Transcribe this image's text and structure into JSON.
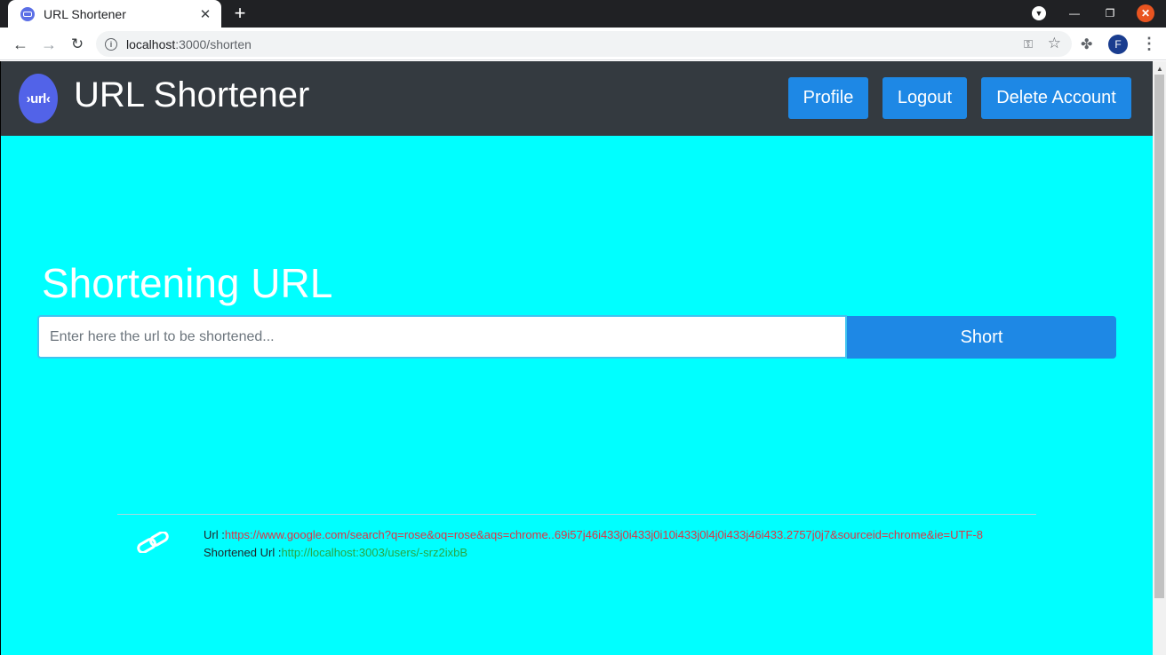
{
  "browser": {
    "tab_title": "URL Shortener",
    "tab_close": "✕",
    "new_tab": "+",
    "url_host": "localhost",
    "url_rest": ":3000/shorten",
    "profile_initial": "F"
  },
  "navbar": {
    "logo_text": "›url‹",
    "brand": "URL Shortener",
    "profile_label": "Profile",
    "logout_label": "Logout",
    "delete_label": "Delete Account"
  },
  "main": {
    "heading": "Shortening URL",
    "input_placeholder": "Enter here the url to be shortened...",
    "input_value": "",
    "short_label": "Short"
  },
  "result": {
    "url_label": "Url :",
    "url_value": "https://www.google.com/search?q=rose&oq=rose&aqs=chrome..69i57j46i433j0i433j0i10i433j0l4j0i433j46i433.2757j0j7&sourceid=chrome&ie=UTF-8",
    "short_label": "Shortened Url :",
    "short_value": "http://localhost:3003/users/-srz2ixbB"
  },
  "colors": {
    "page_bg": "#00ffff",
    "navbar_bg": "#343a40",
    "button_bg": "#1e88e5",
    "url_value": "#dc3545",
    "short_value": "#28a745"
  }
}
